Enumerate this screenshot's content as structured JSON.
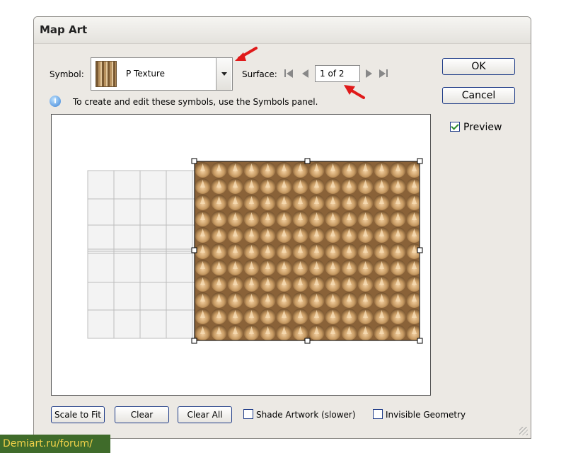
{
  "dialog": {
    "title": "Map Art",
    "symbol_label": "Symbol:",
    "symbol_value": "P Texture",
    "surface_label": "Surface:",
    "surface_value": "1 of 2",
    "info_text": "To create and edit these symbols, use the Symbols panel.",
    "ok_label": "OK",
    "cancel_label": "Cancel",
    "preview_label": "Preview",
    "preview_checked": true,
    "scale_to_fit_label": "Scale to Fit",
    "clear_label": "Clear",
    "clear_all_label": "Clear All",
    "shade_artwork_label": "Shade Artwork (slower)",
    "shade_artwork_checked": false,
    "invisible_geometry_label": "Invisible Geometry",
    "invisible_geometry_checked": false
  },
  "watermark": "Demiart.ru/forum/",
  "colors": {
    "accent_border": "#1f3c88",
    "arrow": "#e01a1a",
    "texture_dark": "#6e4d2a",
    "texture_light": "#f2cfa0"
  }
}
